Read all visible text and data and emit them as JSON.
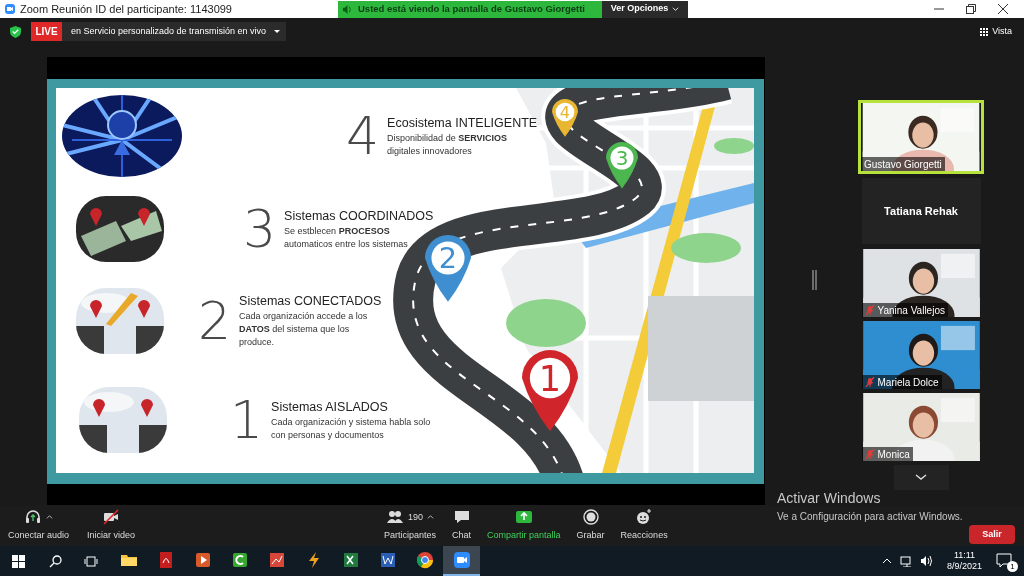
{
  "title_bar": {
    "title": "Zoom Reunión ID del participante: 1143099"
  },
  "share_banner": {
    "text": "Usted está viendo la pantalla de Gustavo Giorgetti",
    "options": "Ver Opciones"
  },
  "meeting_bar": {
    "live": "LIVE",
    "stream": "en Servicio personalizado de transmisión en vivo",
    "view": "Vista"
  },
  "slide": {
    "stages": [
      {
        "number": "4",
        "title": "Ecosistema INTELIGENTE",
        "description": "Disponibilidad de **SERVICIOS** digitales innovadores"
      },
      {
        "number": "3",
        "title": "Sistemas COORDINADOS",
        "description": "Se estblecen **PROCESOS** automaticos entre los sistemas"
      },
      {
        "number": "2",
        "title": "Sistemas CONECTADOS",
        "description": "Cada organización accede a los **DATOS** del sistema que los produce."
      },
      {
        "number": "1",
        "title": "Sistemas AISLADOS",
        "description": "Cada organización y sistema habla solo con personas y documentos"
      }
    ],
    "pins": [
      {
        "label": "4",
        "color": "#e8b631"
      },
      {
        "label": "3",
        "color": "#4cb74e"
      },
      {
        "label": "2",
        "color": "#3f8fd0"
      },
      {
        "label": "1",
        "color": "#d0262b"
      }
    ]
  },
  "participants": [
    {
      "kind": "video",
      "name": "Gustavo Giorgetti",
      "speaking": true,
      "muted": false
    },
    {
      "kind": "name",
      "name": "Tatiana Rehak",
      "speaking": false,
      "muted": false
    },
    {
      "kind": "video",
      "name": "Yanina Vallejos",
      "speaking": false,
      "muted": true
    },
    {
      "kind": "video",
      "name": "Mariela Dolce",
      "speaking": false,
      "muted": true
    },
    {
      "kind": "video",
      "name": "Monica",
      "speaking": false,
      "muted": true
    }
  ],
  "toolbar": [
    {
      "kind": "audio",
      "label": "Conectar audio",
      "caret": true,
      "active": false
    },
    {
      "kind": "video",
      "label": "Iniciar video",
      "caret": false,
      "active": false
    },
    {
      "kind": "participants",
      "label": "Participantes",
      "count": "190",
      "caret": true,
      "active": false
    },
    {
      "kind": "chat",
      "label": "Chat",
      "caret": false,
      "active": false
    },
    {
      "kind": "share",
      "label": "Compartir pantalla",
      "caret": false,
      "active": true
    },
    {
      "kind": "record",
      "label": "Grabar",
      "caret": false,
      "active": false
    },
    {
      "kind": "reactions",
      "label": "Reacciones",
      "caret": false,
      "active": false
    }
  ],
  "leave_button": "Salir",
  "activation_notice": {
    "title": "Activar Windows",
    "text": "Ve a Configuración para activar Windows."
  },
  "taskbar": {
    "apps": [
      {
        "kind": "folder",
        "active": false
      },
      {
        "kind": "pdf",
        "active": false
      },
      {
        "kind": "player",
        "active": false
      },
      {
        "kind": "editor",
        "active": false
      },
      {
        "kind": "chart",
        "active": false
      },
      {
        "kind": "bolt",
        "active": false
      },
      {
        "kind": "sheet",
        "active": false
      },
      {
        "kind": "doc",
        "active": false
      },
      {
        "kind": "browser",
        "active": false
      },
      {
        "kind": "meeting",
        "active": true
      }
    ],
    "time": "11:11",
    "date": "8/9/2021",
    "notifications": "1"
  }
}
